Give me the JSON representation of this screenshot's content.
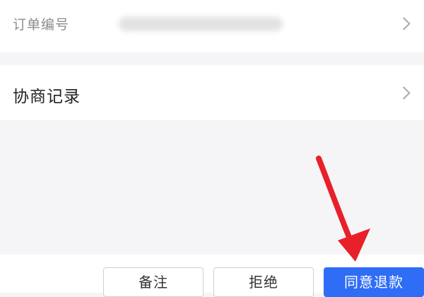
{
  "rows": {
    "order_number": {
      "label": "订单编号",
      "icon": "chevron-right-icon"
    },
    "negotiation": {
      "label": "协商记录",
      "icon": "chevron-right-icon"
    }
  },
  "footer": {
    "note_label": "备注",
    "reject_label": "拒绝",
    "agree_label": "同意退款"
  },
  "annotation": {
    "arrow_color": "#e8202a",
    "icon": "red-arrow-icon"
  },
  "colors": {
    "primary": "#2f6df6",
    "background": "#f5f5f7"
  }
}
